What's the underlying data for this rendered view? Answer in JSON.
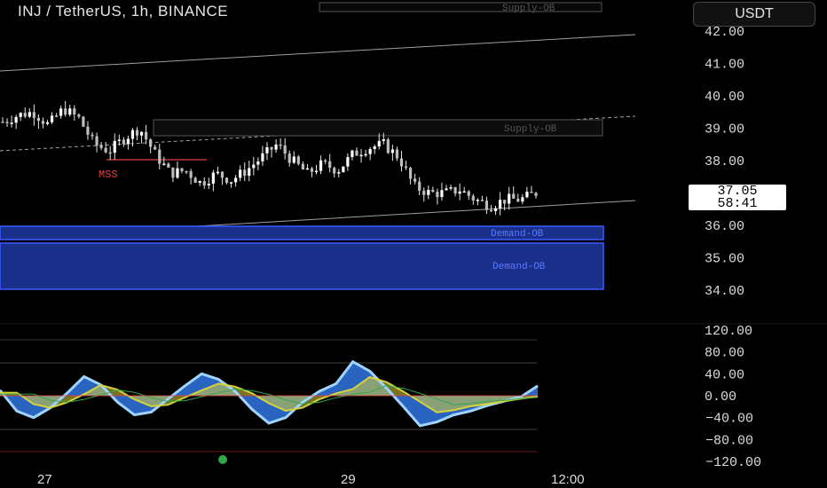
{
  "header": {
    "title": "INJ / TetherUS, 1h, BINANCE",
    "currency": "USDT"
  },
  "price_box": {
    "price": "37.05",
    "countdown": "58:41"
  },
  "labels": {
    "supply_top": "Supply-OB",
    "supply_mid": "Supply-OB",
    "demand_1": "Demand-OB",
    "demand_2": "Demand-OB",
    "mss": "MSS"
  },
  "colors": {
    "demand_fill": "#1a2f8a",
    "demand_border": "#3b5bff",
    "supply_border": "#555555",
    "osc_blue": "#2f6fd6",
    "osc_light_blue": "#9fd4ff",
    "osc_yellow": "#d8d23a",
    "osc_red": "#e04040",
    "osc_green": "#2fa84a"
  },
  "chart_data": [
    {
      "type": "candlestick",
      "symbol": "INJ / TetherUS",
      "timeframe": "1h",
      "exchange": "BINANCE",
      "y_ticks": [
        "42.00",
        "41.00",
        "40.00",
        "39.00",
        "38.00",
        "36.00",
        "35.00",
        "34.00"
      ],
      "ylim": [
        33.5,
        42.3
      ],
      "x_ticks": [
        "27",
        "29",
        "12:00"
      ],
      "last_price": 37.05,
      "approx_close_path": [
        39.2,
        39.4,
        39.5,
        39.1,
        39.6,
        39.3,
        38.5,
        38.3,
        38.7,
        39.0,
        38.2,
        37.6,
        37.7,
        37.3,
        37.6,
        37.4,
        37.7,
        38.1,
        38.5,
        38.0,
        37.6,
        37.9,
        37.7,
        38.2,
        38.4,
        38.5,
        38.1,
        37.2,
        37.0,
        37.0,
        37.1,
        36.8,
        36.6,
        36.8,
        36.8,
        37.0
      ],
      "zones": [
        {
          "kind": "Supply-OB",
          "low": 38.75,
          "high": 39.2
        },
        {
          "kind": "Demand-OB",
          "low": 35.8,
          "high": 36.05
        },
        {
          "kind": "Demand-OB",
          "low": 34.0,
          "high": 35.45
        }
      ]
    },
    {
      "type": "line",
      "name": "oscillator",
      "y_ticks": [
        "120.00",
        "80.00",
        "40.00",
        "0.00",
        "−40.00",
        "−80.00",
        "−120.00"
      ],
      "ylim": [
        -120,
        120
      ],
      "series_main": [
        10,
        -28,
        -40,
        -22,
        5,
        35,
        20,
        -12,
        -35,
        -30,
        -6,
        18,
        40,
        30,
        8,
        -25,
        -50,
        -40,
        -12,
        8,
        22,
        62,
        45,
        14,
        -20,
        -55,
        -48,
        -35,
        -28,
        -18,
        -10,
        -2,
        18
      ]
    }
  ]
}
